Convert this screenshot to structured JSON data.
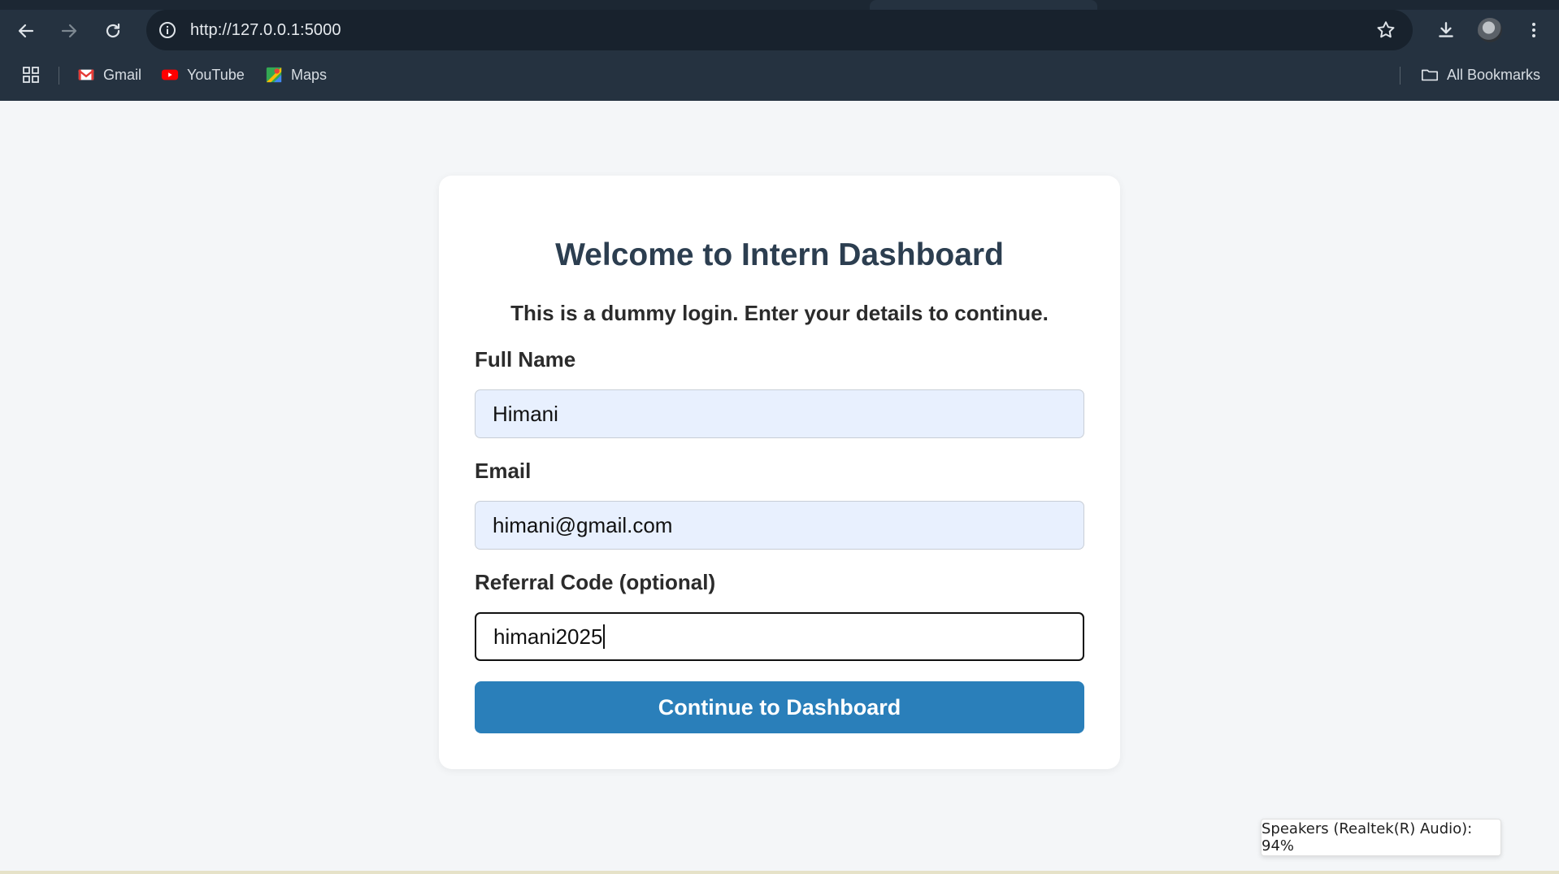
{
  "browser": {
    "url": "http://127.0.0.1:5000",
    "bookmarks": [
      {
        "label": "Gmail",
        "icon": "gmail-icon"
      },
      {
        "label": "YouTube",
        "icon": "youtube-icon"
      },
      {
        "label": "Maps",
        "icon": "maps-icon"
      }
    ],
    "all_bookmarks_label": "All Bookmarks"
  },
  "page": {
    "title": "Welcome to Intern Dashboard",
    "subtitle": "This is a dummy login. Enter your details to continue.",
    "form": {
      "name_label": "Full Name",
      "name_value": "Himani",
      "email_label": "Email",
      "email_value": "himani@gmail.com",
      "referral_label": "Referral Code (optional)",
      "referral_value": "himani2025",
      "submit_label": "Continue to Dashboard"
    }
  },
  "system": {
    "volume_toast": "Speakers (Realtek(R) Audio): 94%"
  },
  "colors": {
    "chrome": "#253240",
    "page_bg": "#f4f6f8",
    "title": "#2c3e50",
    "button": "#2a7fba",
    "autofill": "#e8f0fe"
  }
}
